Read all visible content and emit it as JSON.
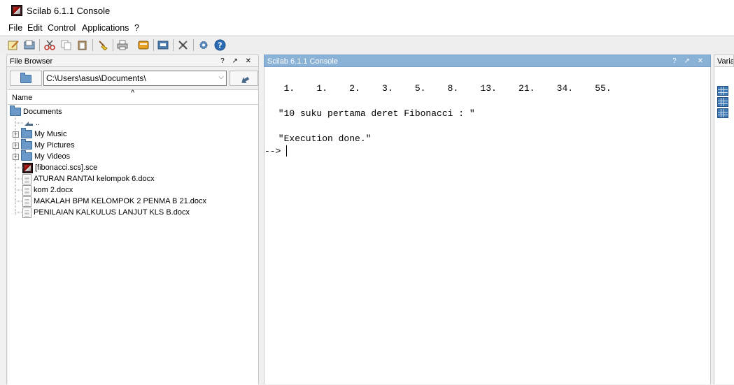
{
  "window": {
    "title": "Scilab 6.1.1 Console"
  },
  "menu": {
    "file": "File",
    "edit": "Edit",
    "control": "Control",
    "applications": "Applications",
    "help": "?"
  },
  "toolbar": {
    "icons": [
      "new-script-icon",
      "open-file-icon",
      "cut-icon",
      "copy-icon",
      "paste-icon",
      "clear-console-icon",
      "print-icon",
      "variable-browser-icon",
      "xcos-icon",
      "module-manager-icon",
      "preferences-icon",
      "help-icon"
    ]
  },
  "file_browser": {
    "header": "File Browser",
    "header_buttons": "? ↗ ✕",
    "path": "C:\\Users\\asus\\Documents\\",
    "column_name": "Name",
    "sort_indicator": "^",
    "root": "Documents",
    "parent_label": "..",
    "items": [
      {
        "label": "My Music",
        "type": "folder"
      },
      {
        "label": "My Pictures",
        "type": "folder"
      },
      {
        "label": "My Videos",
        "type": "folder"
      },
      {
        "label": "[fibonacci.scs].sce",
        "type": "sce"
      },
      {
        "label": "ATURAN RANTAI kelompok 6.docx",
        "type": "doc"
      },
      {
        "label": "kom 2.docx",
        "type": "doc"
      },
      {
        "label": "MAKALAH BPM KELOMPOK 2 PENMA B 21.docx",
        "type": "doc"
      },
      {
        "label": "PENILAIAN KALKULUS LANJUT KLS B.docx",
        "type": "doc"
      }
    ]
  },
  "console": {
    "header": "Scilab 6.1.1 Console",
    "header_buttons": "? ↗ ✕",
    "output_numbers": "  1.    1.    2.    3.    5.    8.    13.    21.    34.    55.",
    "output_message": " \"10 suku pertama deret Fibonacci : \"",
    "output_done": " \"Execution done.\"",
    "prompt": "-->"
  },
  "variable_browser": {
    "header": "Varia"
  },
  "colors": {
    "active_header": "#8ab1d6",
    "folder": "#6a98c9"
  }
}
